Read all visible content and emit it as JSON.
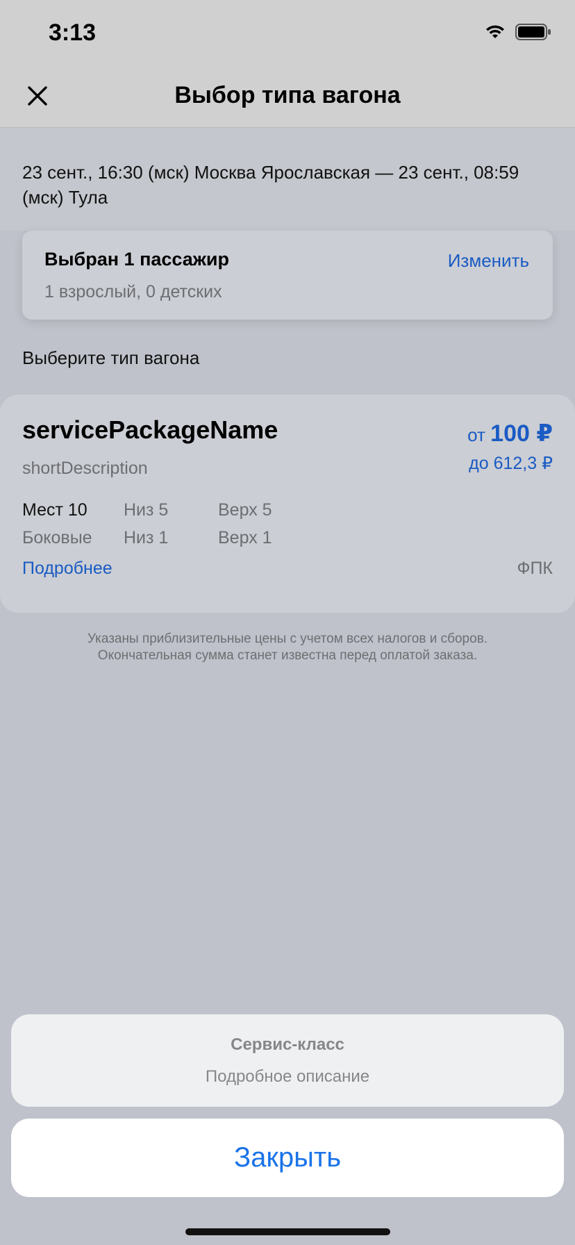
{
  "status_bar": {
    "time": "3:13"
  },
  "nav": {
    "title": "Выбор типа вагона",
    "close_icon": "close-icon"
  },
  "route": {
    "text": "23 сент., 16:30 (мск) Москва Ярославская — 23 сент., 08:59 (мск) Тула"
  },
  "passengers": {
    "title": "Выбран 1 пассажир",
    "subtitle": "1 взрослый, 0 детских",
    "change_label": "Изменить"
  },
  "section_label": "Выберите тип вагона",
  "car": {
    "name": "servicePackageName",
    "description": "shortDescription",
    "price_from_prefix": "от",
    "price_from": "100 ₽",
    "price_to": "до 612,3 ₽",
    "seats": {
      "total": "Мест 10",
      "lower": "Низ 5",
      "upper": "Верх 5"
    },
    "side": {
      "label": "Боковые",
      "lower": "Низ 1",
      "upper": "Верх 1"
    },
    "details_label": "Подробнее",
    "carrier": "ФПК"
  },
  "disclaimer": {
    "line1": "Указаны приблизительные цены с учетом всех налогов и сборов.",
    "line2": "Окончательная сумма станет известна перед оплатой заказа."
  },
  "action_sheet": {
    "title": "Сервис-класс",
    "subtitle": "Подробное описание",
    "close_label": "Закрыть"
  },
  "colors": {
    "accent": "#1a5bc4",
    "button_text": "#1a73e8",
    "overlay_background": "#bfc2ca"
  }
}
